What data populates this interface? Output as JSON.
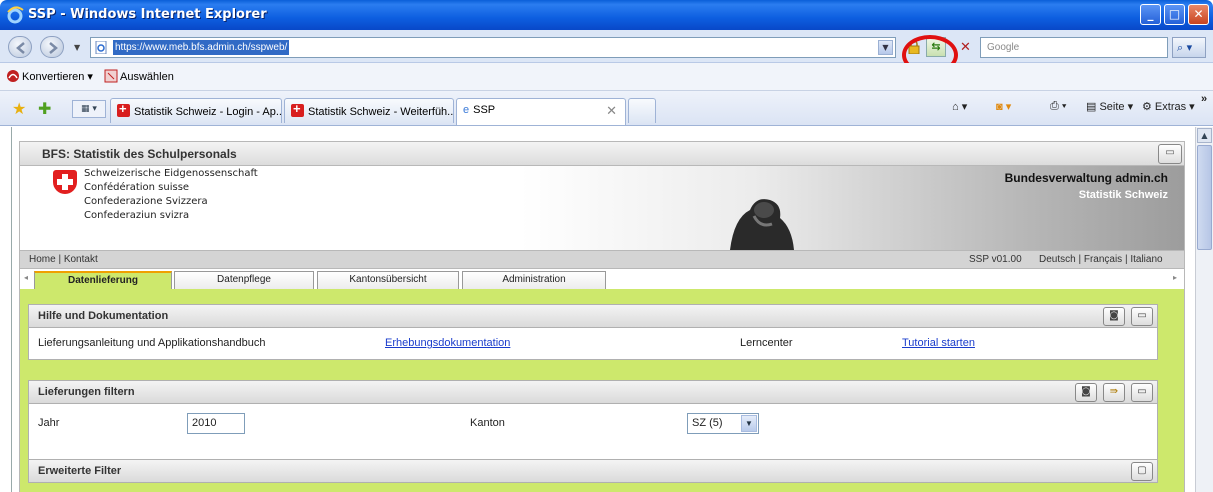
{
  "window": {
    "title": "SSP - Windows Internet Explorer"
  },
  "address": {
    "url": "https://www.meb.bfs.admin.ch/sspweb/",
    "search_placeholder": "Google"
  },
  "links_bar": {
    "convert_label": "Konvertieren",
    "select_label": "Auswählen"
  },
  "browser_tabs": [
    {
      "label": "Statistik Schweiz - Login - Ap..."
    },
    {
      "label": "Statistik Schweiz - Weiterfüh..."
    },
    {
      "label": "SSP"
    }
  ],
  "command_bar": {
    "page_label": "Seite",
    "extras_label": "Extras"
  },
  "app": {
    "header_title": "BFS: Statistik des Schulpersonals",
    "confed_lines": [
      "Schweizerische Eidgenossenschaft",
      "Confédération suisse",
      "Confederazione Svizzera",
      "Confederaziun svizra"
    ],
    "admin_label": "Bundesverwaltung admin.ch",
    "stat_label": "Statistik Schweiz",
    "home_contact": "Home | Kontakt",
    "version": "SSP v01.00",
    "languages": "Deutsch | Français | Italiano",
    "tabs": [
      {
        "label": "Datenlieferung",
        "active": true
      },
      {
        "label": "Datenpflege",
        "active": false
      },
      {
        "label": "Kantonsübersicht",
        "active": false
      },
      {
        "label": "Administration",
        "active": false
      }
    ]
  },
  "help_panel": {
    "title": "Hilfe und Dokumentation",
    "manual_label": "Lieferungsanleitung und Applikationshandbuch",
    "doc_link": "Erhebungsdokumentation",
    "learncenter_label": "Lerncenter",
    "tutorial_link": "Tutorial starten"
  },
  "filter_panel": {
    "title": "Lieferungen filtern",
    "year_label": "Jahr",
    "year_value": "2010",
    "canton_label": "Kanton",
    "canton_value": "SZ (5)"
  },
  "extended_filter": {
    "title": "Erweiterte Filter"
  },
  "colors": {
    "accent_green": "#cde86c",
    "link_blue": "#1a3ccc",
    "highlight_red": "#e01010",
    "title_blue": "#0d5ee0"
  }
}
